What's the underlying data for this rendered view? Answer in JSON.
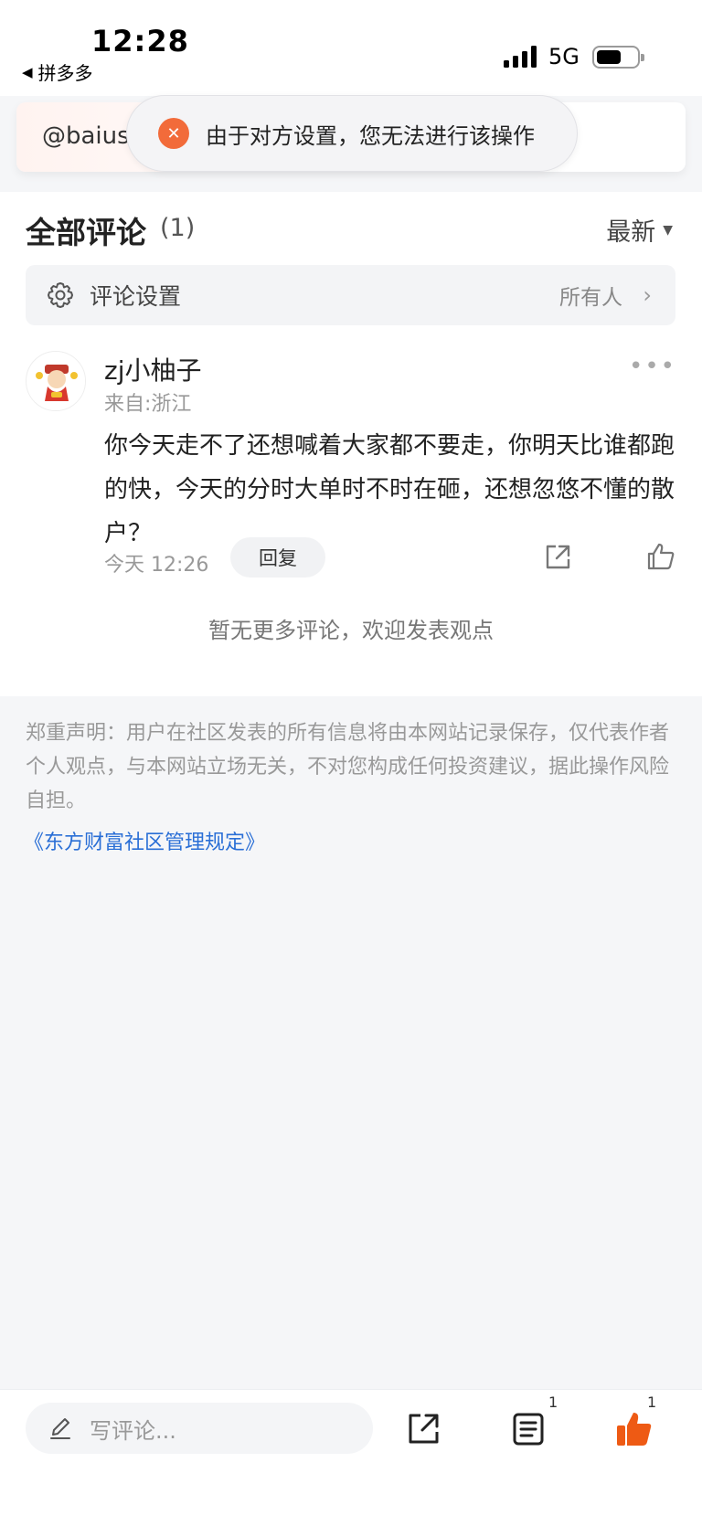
{
  "status_bar": {
    "time": "12:28",
    "back_app": "拼多多",
    "network": "5G",
    "battery_level": 0.6
  },
  "banner": {
    "text": "@baius"
  },
  "toast": {
    "message": "由于对方设置，您无法进行该操作",
    "icon": "close-icon"
  },
  "comments_section": {
    "title": "全部评论",
    "count": "(1)",
    "sort": "最新"
  },
  "settings": {
    "label": "评论设置",
    "value": "所有人"
  },
  "comment": {
    "username": "zj小柚子",
    "location": "来自:浙江",
    "text": "你今天走不了还想喊着大家都不要走，你明天比谁都跑的快，今天的分时大单时不时在砸，还想忽悠不懂的散户？",
    "time": "今天 12:26",
    "reply_label": "回复"
  },
  "no_more": "暂无更多评论，欢迎发表观点",
  "disclaimer": {
    "text": "郑重声明：用户在社区发表的所有信息将由本网站记录保存，仅代表作者个人观点，与本网站立场无关，不对您构成任何投资建议，据此操作风险自担。",
    "link": "《东方财富社区管理规定》"
  },
  "bottom_bar": {
    "comment_placeholder": "写评论...",
    "list_count": "1",
    "like_count": "1",
    "like_color": "#ee5a14"
  }
}
